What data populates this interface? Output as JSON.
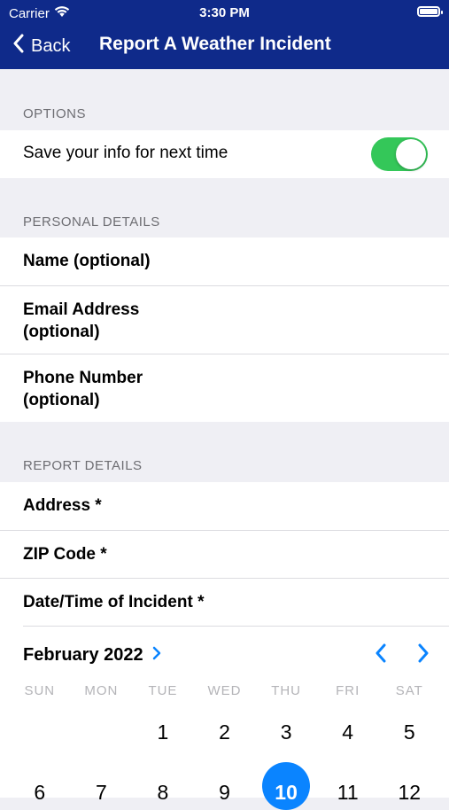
{
  "status_bar": {
    "carrier": "Carrier",
    "time": "3:30 PM"
  },
  "nav": {
    "back_label": "Back",
    "title": "Report A Weather Incident"
  },
  "options": {
    "header": "OPTIONS",
    "save_info_label": "Save your info for next time",
    "save_info_enabled": true
  },
  "personal": {
    "header": "PERSONAL DETAILS",
    "name_label": "Name (optional)",
    "email_label_line1": "Email Address",
    "email_label_line2": "(optional)",
    "phone_label_line1": "Phone Number",
    "phone_label_line2": "(optional)"
  },
  "report": {
    "header": "REPORT DETAILS",
    "address_label": "Address *",
    "zip_label": "ZIP Code *",
    "datetime_label": "Date/Time of Incident *"
  },
  "calendar": {
    "month_label": "February 2022",
    "weekdays": [
      "SUN",
      "MON",
      "TUE",
      "WED",
      "THU",
      "FRI",
      "SAT"
    ],
    "week1": [
      "",
      "",
      "1",
      "2",
      "3",
      "4",
      "5"
    ],
    "week2": [
      "6",
      "7",
      "8",
      "9",
      "10",
      "11",
      "12"
    ],
    "selected_day": "10"
  },
  "colors": {
    "nav_background": "#0f2a8a",
    "toggle_on": "#34c759",
    "accent": "#0a84ff"
  },
  "icons": {
    "back": "chevron-left-icon",
    "month_expand": "chevron-right-icon",
    "prev_month": "chevron-left-icon",
    "next_month": "chevron-right-icon",
    "wifi": "wifi-icon",
    "battery": "battery-icon"
  }
}
